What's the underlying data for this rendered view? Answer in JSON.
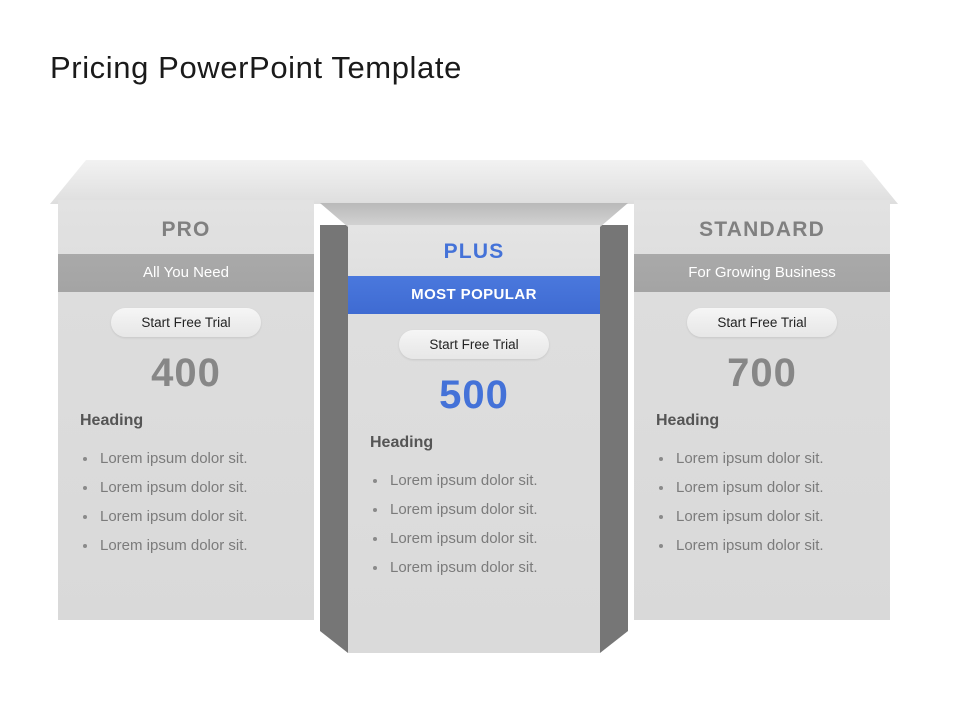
{
  "slide": {
    "title": "Pricing PowerPoint Template",
    "background_color": "#ffffff"
  },
  "theme": {
    "accent_blue": "#4472d8",
    "band_grey": "#a6a6a6",
    "column_face": "#dcdcdc",
    "side_face_dark": "#767676",
    "title_color": "#1a1a1a",
    "tier_name_grey": "#808080",
    "price_grey": "#878787",
    "feature_text": "#7b7b7b"
  },
  "plans": {
    "pro": {
      "tier_name": "PRO",
      "tagline": "All You Need",
      "cta_label": "Start Free Trial",
      "price": "400",
      "features_heading": "Heading",
      "features": [
        "Lorem ipsum dolor sit.",
        "Lorem ipsum dolor sit.",
        "Lorem ipsum dolor sit.",
        "Lorem ipsum dolor sit."
      ]
    },
    "plus": {
      "tier_name": "PLUS",
      "badge_label": "MOST POPULAR",
      "cta_label": "Start Free Trial",
      "price": "500",
      "features_heading": "Heading",
      "features": [
        "Lorem ipsum dolor sit.",
        "Lorem ipsum dolor sit.",
        "Lorem ipsum dolor sit.",
        "Lorem ipsum dolor sit."
      ]
    },
    "standard": {
      "tier_name": "STANDARD",
      "tagline": "For Growing Business",
      "cta_label": "Start Free Trial",
      "price": "700",
      "features_heading": "Heading",
      "features": [
        "Lorem ipsum dolor sit.",
        "Lorem ipsum dolor sit.",
        "Lorem ipsum dolor sit.",
        "Lorem ipsum dolor sit."
      ]
    }
  }
}
